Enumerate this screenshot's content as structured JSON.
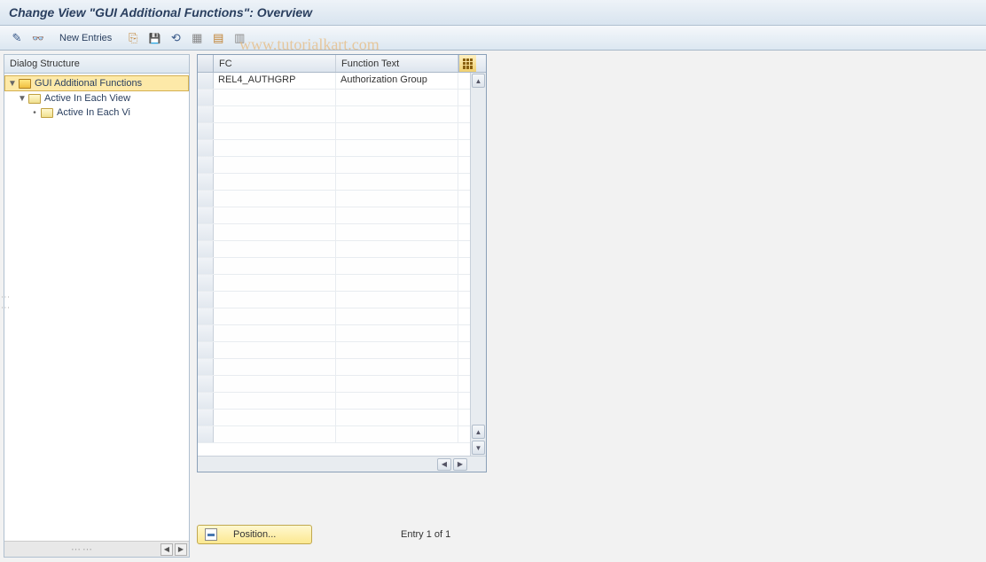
{
  "title": "Change View \"GUI Additional Functions\": Overview",
  "toolbar": {
    "new_entries_label": "New Entries"
  },
  "watermark": "www.tutorialkart.com",
  "sidebar": {
    "header": "Dialog Structure",
    "items": [
      {
        "label": "GUI Additional Functions",
        "level": 0,
        "open": true,
        "selected": true
      },
      {
        "label": "Active In Each View",
        "level": 1,
        "open": true,
        "selected": false
      },
      {
        "label": "Active In Each Vi",
        "level": 2,
        "open": false,
        "selected": false
      }
    ]
  },
  "table": {
    "columns": {
      "fc": "FC",
      "ft": "Function Text"
    },
    "rows": [
      {
        "fc": "REL4_AUTHGRP",
        "ft": "Authorization Group"
      }
    ],
    "empty_rows": 21
  },
  "footer": {
    "position_label": "Position...",
    "entry_text": "Entry 1 of 1"
  }
}
